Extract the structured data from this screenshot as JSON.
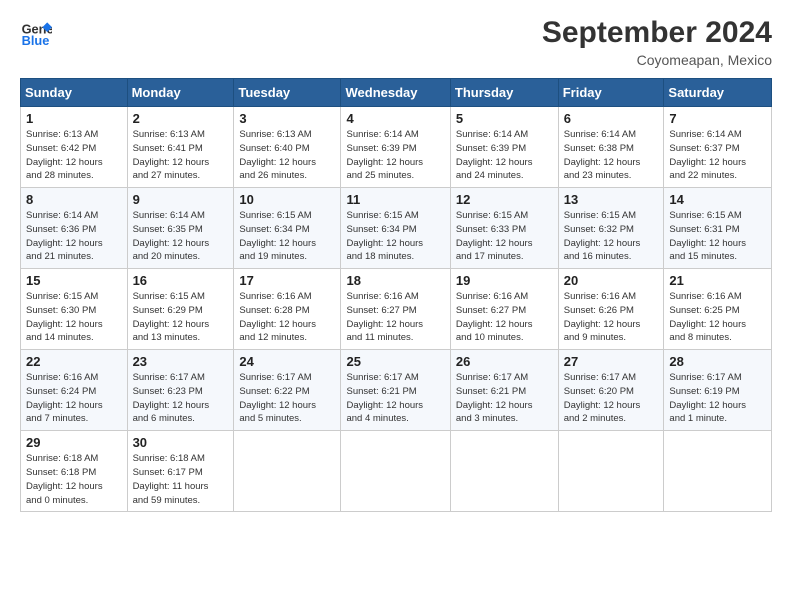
{
  "logo": {
    "line1": "General",
    "line2": "Blue"
  },
  "title": {
    "month_year": "September 2024",
    "location": "Coyomeapan, Mexico"
  },
  "weekdays": [
    "Sunday",
    "Monday",
    "Tuesday",
    "Wednesday",
    "Thursday",
    "Friday",
    "Saturday"
  ],
  "weeks": [
    [
      {
        "day": "1",
        "info": "Sunrise: 6:13 AM\nSunset: 6:42 PM\nDaylight: 12 hours\nand 28 minutes."
      },
      {
        "day": "2",
        "info": "Sunrise: 6:13 AM\nSunset: 6:41 PM\nDaylight: 12 hours\nand 27 minutes."
      },
      {
        "day": "3",
        "info": "Sunrise: 6:13 AM\nSunset: 6:40 PM\nDaylight: 12 hours\nand 26 minutes."
      },
      {
        "day": "4",
        "info": "Sunrise: 6:14 AM\nSunset: 6:39 PM\nDaylight: 12 hours\nand 25 minutes."
      },
      {
        "day": "5",
        "info": "Sunrise: 6:14 AM\nSunset: 6:39 PM\nDaylight: 12 hours\nand 24 minutes."
      },
      {
        "day": "6",
        "info": "Sunrise: 6:14 AM\nSunset: 6:38 PM\nDaylight: 12 hours\nand 23 minutes."
      },
      {
        "day": "7",
        "info": "Sunrise: 6:14 AM\nSunset: 6:37 PM\nDaylight: 12 hours\nand 22 minutes."
      }
    ],
    [
      {
        "day": "8",
        "info": "Sunrise: 6:14 AM\nSunset: 6:36 PM\nDaylight: 12 hours\nand 21 minutes."
      },
      {
        "day": "9",
        "info": "Sunrise: 6:14 AM\nSunset: 6:35 PM\nDaylight: 12 hours\nand 20 minutes."
      },
      {
        "day": "10",
        "info": "Sunrise: 6:15 AM\nSunset: 6:34 PM\nDaylight: 12 hours\nand 19 minutes."
      },
      {
        "day": "11",
        "info": "Sunrise: 6:15 AM\nSunset: 6:34 PM\nDaylight: 12 hours\nand 18 minutes."
      },
      {
        "day": "12",
        "info": "Sunrise: 6:15 AM\nSunset: 6:33 PM\nDaylight: 12 hours\nand 17 minutes."
      },
      {
        "day": "13",
        "info": "Sunrise: 6:15 AM\nSunset: 6:32 PM\nDaylight: 12 hours\nand 16 minutes."
      },
      {
        "day": "14",
        "info": "Sunrise: 6:15 AM\nSunset: 6:31 PM\nDaylight: 12 hours\nand 15 minutes."
      }
    ],
    [
      {
        "day": "15",
        "info": "Sunrise: 6:15 AM\nSunset: 6:30 PM\nDaylight: 12 hours\nand 14 minutes."
      },
      {
        "day": "16",
        "info": "Sunrise: 6:15 AM\nSunset: 6:29 PM\nDaylight: 12 hours\nand 13 minutes."
      },
      {
        "day": "17",
        "info": "Sunrise: 6:16 AM\nSunset: 6:28 PM\nDaylight: 12 hours\nand 12 minutes."
      },
      {
        "day": "18",
        "info": "Sunrise: 6:16 AM\nSunset: 6:27 PM\nDaylight: 12 hours\nand 11 minutes."
      },
      {
        "day": "19",
        "info": "Sunrise: 6:16 AM\nSunset: 6:27 PM\nDaylight: 12 hours\nand 10 minutes."
      },
      {
        "day": "20",
        "info": "Sunrise: 6:16 AM\nSunset: 6:26 PM\nDaylight: 12 hours\nand 9 minutes."
      },
      {
        "day": "21",
        "info": "Sunrise: 6:16 AM\nSunset: 6:25 PM\nDaylight: 12 hours\nand 8 minutes."
      }
    ],
    [
      {
        "day": "22",
        "info": "Sunrise: 6:16 AM\nSunset: 6:24 PM\nDaylight: 12 hours\nand 7 minutes."
      },
      {
        "day": "23",
        "info": "Sunrise: 6:17 AM\nSunset: 6:23 PM\nDaylight: 12 hours\nand 6 minutes."
      },
      {
        "day": "24",
        "info": "Sunrise: 6:17 AM\nSunset: 6:22 PM\nDaylight: 12 hours\nand 5 minutes."
      },
      {
        "day": "25",
        "info": "Sunrise: 6:17 AM\nSunset: 6:21 PM\nDaylight: 12 hours\nand 4 minutes."
      },
      {
        "day": "26",
        "info": "Sunrise: 6:17 AM\nSunset: 6:21 PM\nDaylight: 12 hours\nand 3 minutes."
      },
      {
        "day": "27",
        "info": "Sunrise: 6:17 AM\nSunset: 6:20 PM\nDaylight: 12 hours\nand 2 minutes."
      },
      {
        "day": "28",
        "info": "Sunrise: 6:17 AM\nSunset: 6:19 PM\nDaylight: 12 hours\nand 1 minute."
      }
    ],
    [
      {
        "day": "29",
        "info": "Sunrise: 6:18 AM\nSunset: 6:18 PM\nDaylight: 12 hours\nand 0 minutes."
      },
      {
        "day": "30",
        "info": "Sunrise: 6:18 AM\nSunset: 6:17 PM\nDaylight: 11 hours\nand 59 minutes."
      },
      null,
      null,
      null,
      null,
      null
    ]
  ]
}
